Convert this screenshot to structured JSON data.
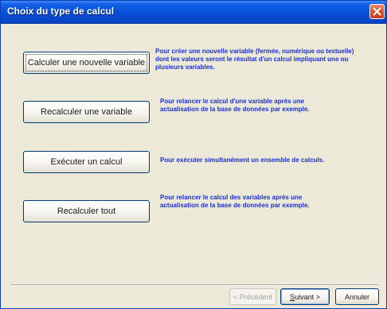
{
  "window": {
    "title": "Choix du type de calcul"
  },
  "options": [
    {
      "button_label": "Calculer une nouvelle variable",
      "description": "Pour créer une nouvelle variable (fermée, numérique ou textuelle) dont les valeurs seront le résultat d'un calcul impliquant une ou plusieurs variables."
    },
    {
      "button_label": "Recalculer une variable",
      "description": "Pour relancer le calcul d'une variable après une actualisation de la base de données par exemple."
    },
    {
      "button_label": "Exécuter un calcul",
      "description": "Pour exécuter simultanément un ensemble de calculs."
    },
    {
      "button_label": "Recalculer tout",
      "description": "Pour relancer le calcul des variables après une actualisation de la base de données par exemple."
    }
  ],
  "footer": {
    "previous_label": "< Précédent",
    "next_label_accel": "S",
    "next_label_rest": "uivant >",
    "cancel_label": "Annuler"
  }
}
